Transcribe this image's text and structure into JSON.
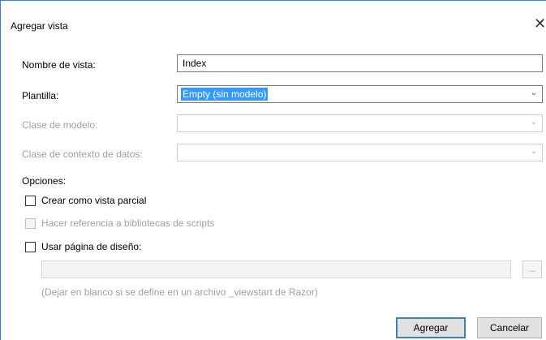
{
  "window": {
    "title": "Agregar vista",
    "close_glyph": "✕"
  },
  "form": {
    "view_name": {
      "label": "Nombre de vista:",
      "value": "Index"
    },
    "template": {
      "label": "Plantilla:",
      "value": "Empty (sin modelo)"
    },
    "model_class": {
      "label": "Clase de modelo:",
      "value": ""
    },
    "data_context_class": {
      "label": "Clase de contexto de datos:",
      "value": ""
    },
    "dropdown_arrow": "⌄"
  },
  "options": {
    "heading": "Opciones:",
    "partial_view": {
      "label": "Crear como vista parcial",
      "checked": false
    },
    "script_libraries": {
      "label": "Hacer referencia a bibliotecas de scripts",
      "checked": false,
      "enabled": false
    },
    "layout_page": {
      "label": "Usar página de diseño:",
      "checked": false
    },
    "layout_path": {
      "value": ""
    },
    "browse_label": "...",
    "layout_hint": "(Dejar en blanco si se define en un archivo _viewstart de Razor)"
  },
  "buttons": {
    "add": "Agregar",
    "cancel": "Cancelar"
  },
  "colors": {
    "accent": "#3a7bd5",
    "selection": "#3399ff",
    "disabled_text": "#a0a0a0"
  }
}
